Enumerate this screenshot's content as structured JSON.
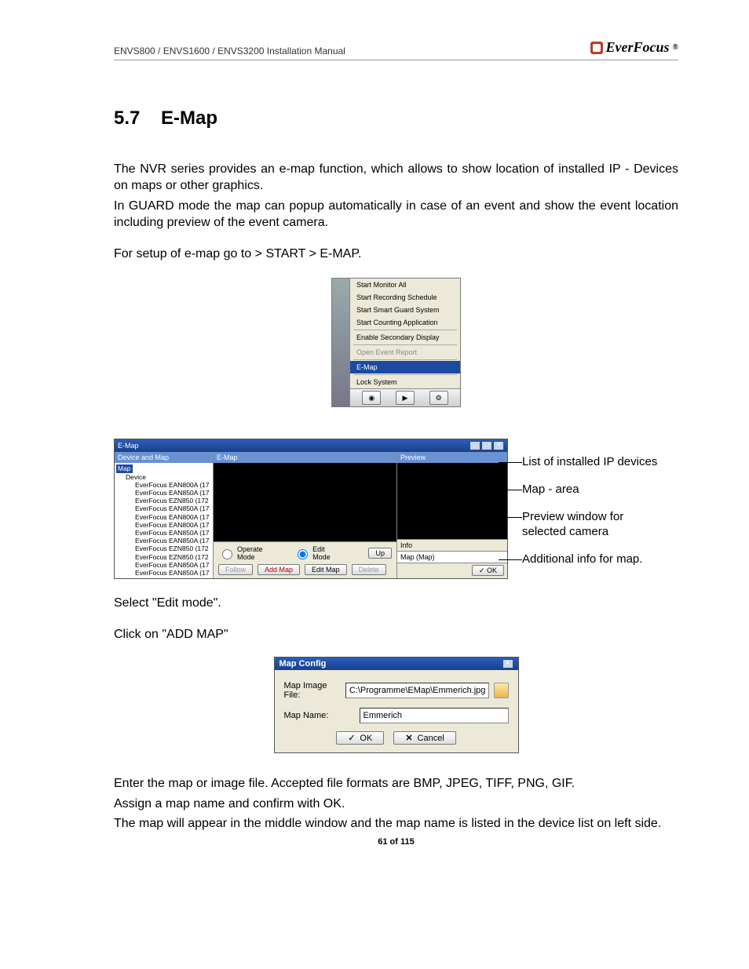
{
  "header": {
    "left": "ENVS800 / ENVS1600 / ENVS3200 Installation Manual",
    "brand": "EverFocus",
    "reg": "®"
  },
  "section": {
    "number": "5.7",
    "title": "E-Map"
  },
  "paragraphs": {
    "p1": "The NVR series provides an e-map function, which allows to show location of installed IP - Devices on maps or other graphics.",
    "p2": "In GUARD mode the map can popup automatically in case of an event and show the event location including preview of the event camera.",
    "p3": "For setup of e-map go to > START > E-MAP.",
    "p4": "Select \"Edit mode\".",
    "p5": "Click on \"ADD MAP\"",
    "p6": "Enter the map or image file. Accepted file formats are BMP, JPEG, TIFF, PNG, GIF.",
    "p7": "Assign a map name and confirm with OK.",
    "p8": "The map will appear in the middle window and the map name is listed in the device list on left side."
  },
  "start_menu": {
    "items": [
      "Start Monitor All",
      "Start Recording Schedule",
      "Start Smart Guard System",
      "Start Counting Application"
    ],
    "sep1": true,
    "items2": [
      "Enable Secondary Display"
    ],
    "disabled": [
      "Open Event Report"
    ],
    "selected": "E-Map",
    "items3": [
      "Lock System"
    ]
  },
  "emap_window": {
    "title": "E-Map",
    "left_head": "Device and Map",
    "mid_head": "E-Map",
    "right_head": "Preview",
    "tree_root": "Map",
    "tree_device": "Device",
    "devices": [
      "EverFocus EAN800A (17",
      "EverFocus EAN850A (17",
      "EverFocus EZN850 (172",
      "EverFocus EAN850A (17",
      "EverFocus EAN800A (17",
      "EverFocus EAN800A (17",
      "EverFocus EAN850A (17",
      "EverFocus EAN850A (17",
      "EverFocus EZN850 (172",
      "EverFocus EZN850 (172",
      "EverFocus EAN850A (17",
      "EverFocus EAN850A (17"
    ],
    "mode_operate": "Operate Mode",
    "mode_edit": "Edit Mode",
    "btn_up": "Up",
    "btn_follow": "Follow",
    "btn_add": "Add Map",
    "btn_edit": "Edit Map",
    "btn_del": "Delete",
    "info_label": "Info",
    "info_value": "Map (Map)",
    "ok": "OK"
  },
  "callouts": {
    "c1": "List of installed IP devices",
    "c2": "Map - area",
    "c3": "Preview window for selected camera",
    "c4": "Additional info for map."
  },
  "dialog": {
    "title": "Map Config",
    "label_file": "Map Image File:",
    "value_file": "C:\\Programme\\EMap\\Emmerich.jpg",
    "label_name": "Map Name:",
    "value_name": "Emmerich",
    "ok": "OK",
    "cancel": "Cancel"
  },
  "footer": {
    "page": "61 of 115"
  }
}
